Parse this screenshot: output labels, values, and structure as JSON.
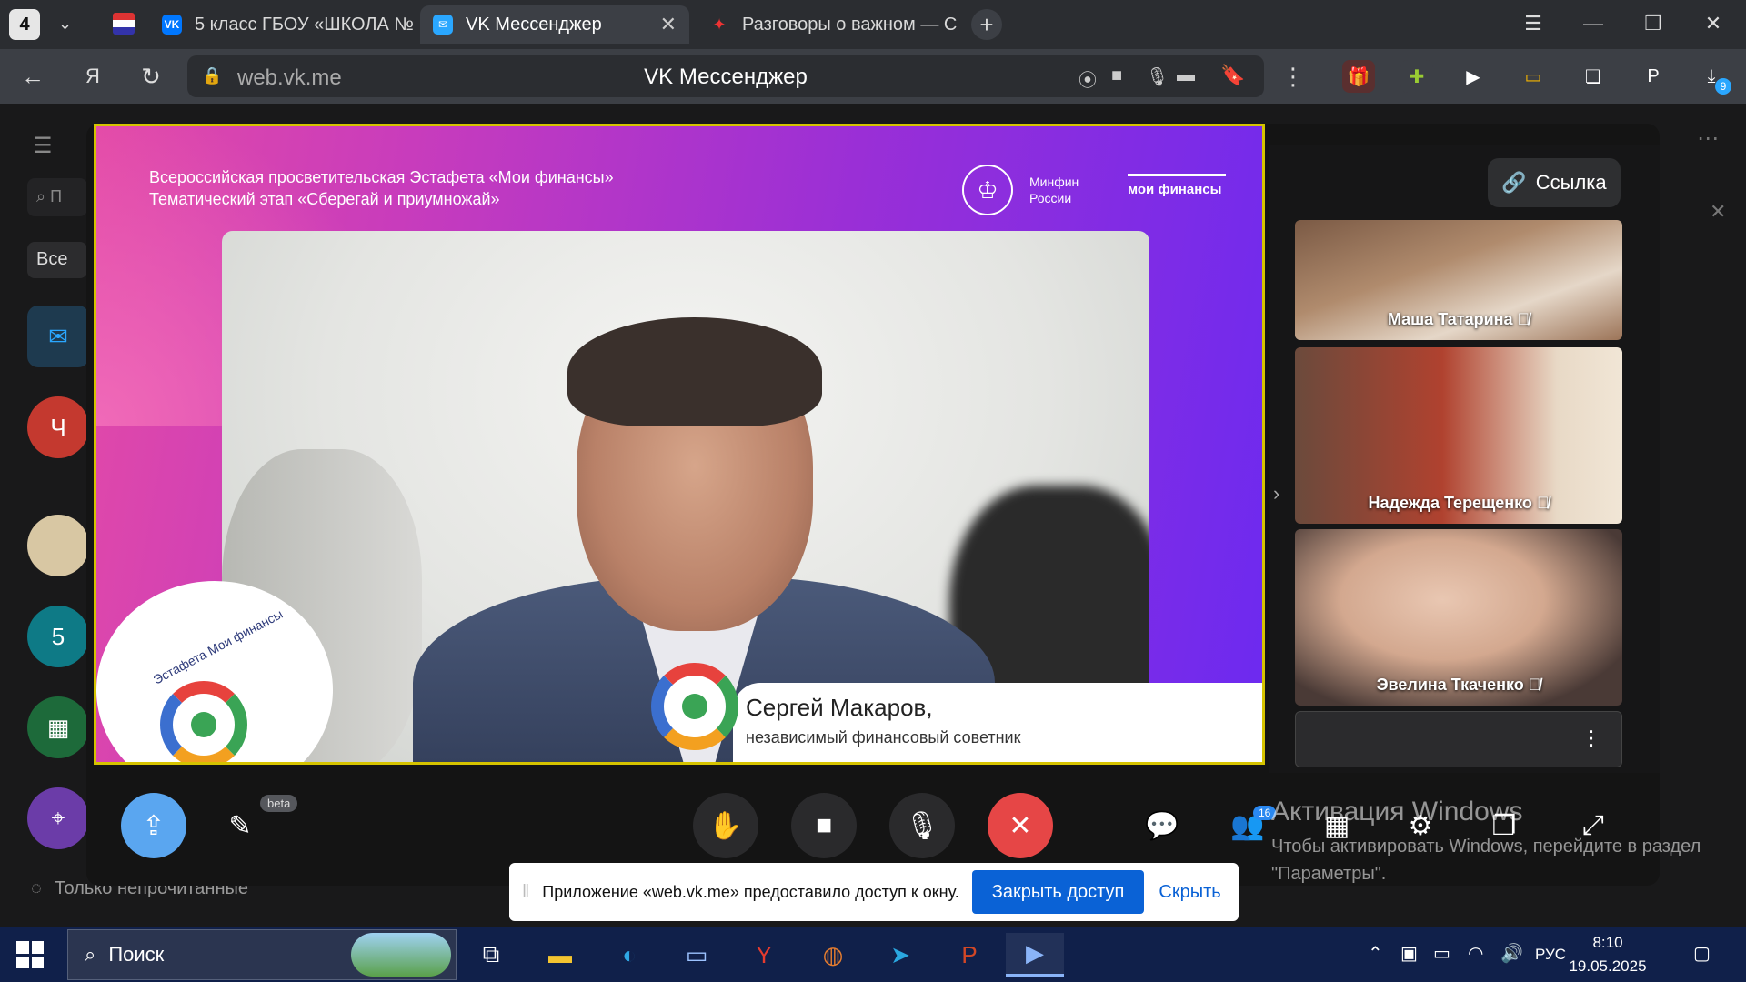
{
  "browser": {
    "tab_counter": "4",
    "tabs": [
      {
        "label": "5 класс ГБОУ «ШКОЛА №"
      },
      {
        "label": "VK Мессенджер"
      },
      {
        "label": "Разговоры о важном — С"
      }
    ],
    "address_url": "web.vk.me",
    "page_title": "VK Мессенджер",
    "downloads_badge": "9"
  },
  "messenger": {
    "filter_all": "Все",
    "search_placeholder": "П",
    "unread_only": "Только непрочитанные",
    "side_avatar_ch": "Ч",
    "side_avatar_5": "5"
  },
  "call": {
    "banner": {
      "line1": "Всероссийская просветительская Эстафета «Мои финансы»",
      "line2": "Тематический этап «Сберегай и приумножай»",
      "ministry": "Минфин России",
      "brand": "мои финансы",
      "relay_logo_text": "Эстафета Мои финансы"
    },
    "speaker_name": "Сергей Макаров,",
    "speaker_role": "независимый финансовый советник",
    "link_button": "Ссылка",
    "participants": [
      {
        "name": "Маша Татарина"
      },
      {
        "name": "Надежда Терещенко"
      },
      {
        "name": "Эвелина Ткаченко"
      }
    ],
    "beta_label": "beta",
    "participants_count": "16"
  },
  "share_bar": {
    "message": "Приложение «web.vk.me» предоставило доступ к окну.",
    "close_access": "Закрыть доступ",
    "hide": "Скрыть"
  },
  "watermark": {
    "title": "Активация Windows",
    "subtitle": "Чтобы активировать Windows, перейдите в раздел \"Параметры\"."
  },
  "taskbar": {
    "search_label": "Поиск",
    "language": "РУС",
    "time": "8:10",
    "date": "19.05.2025"
  }
}
